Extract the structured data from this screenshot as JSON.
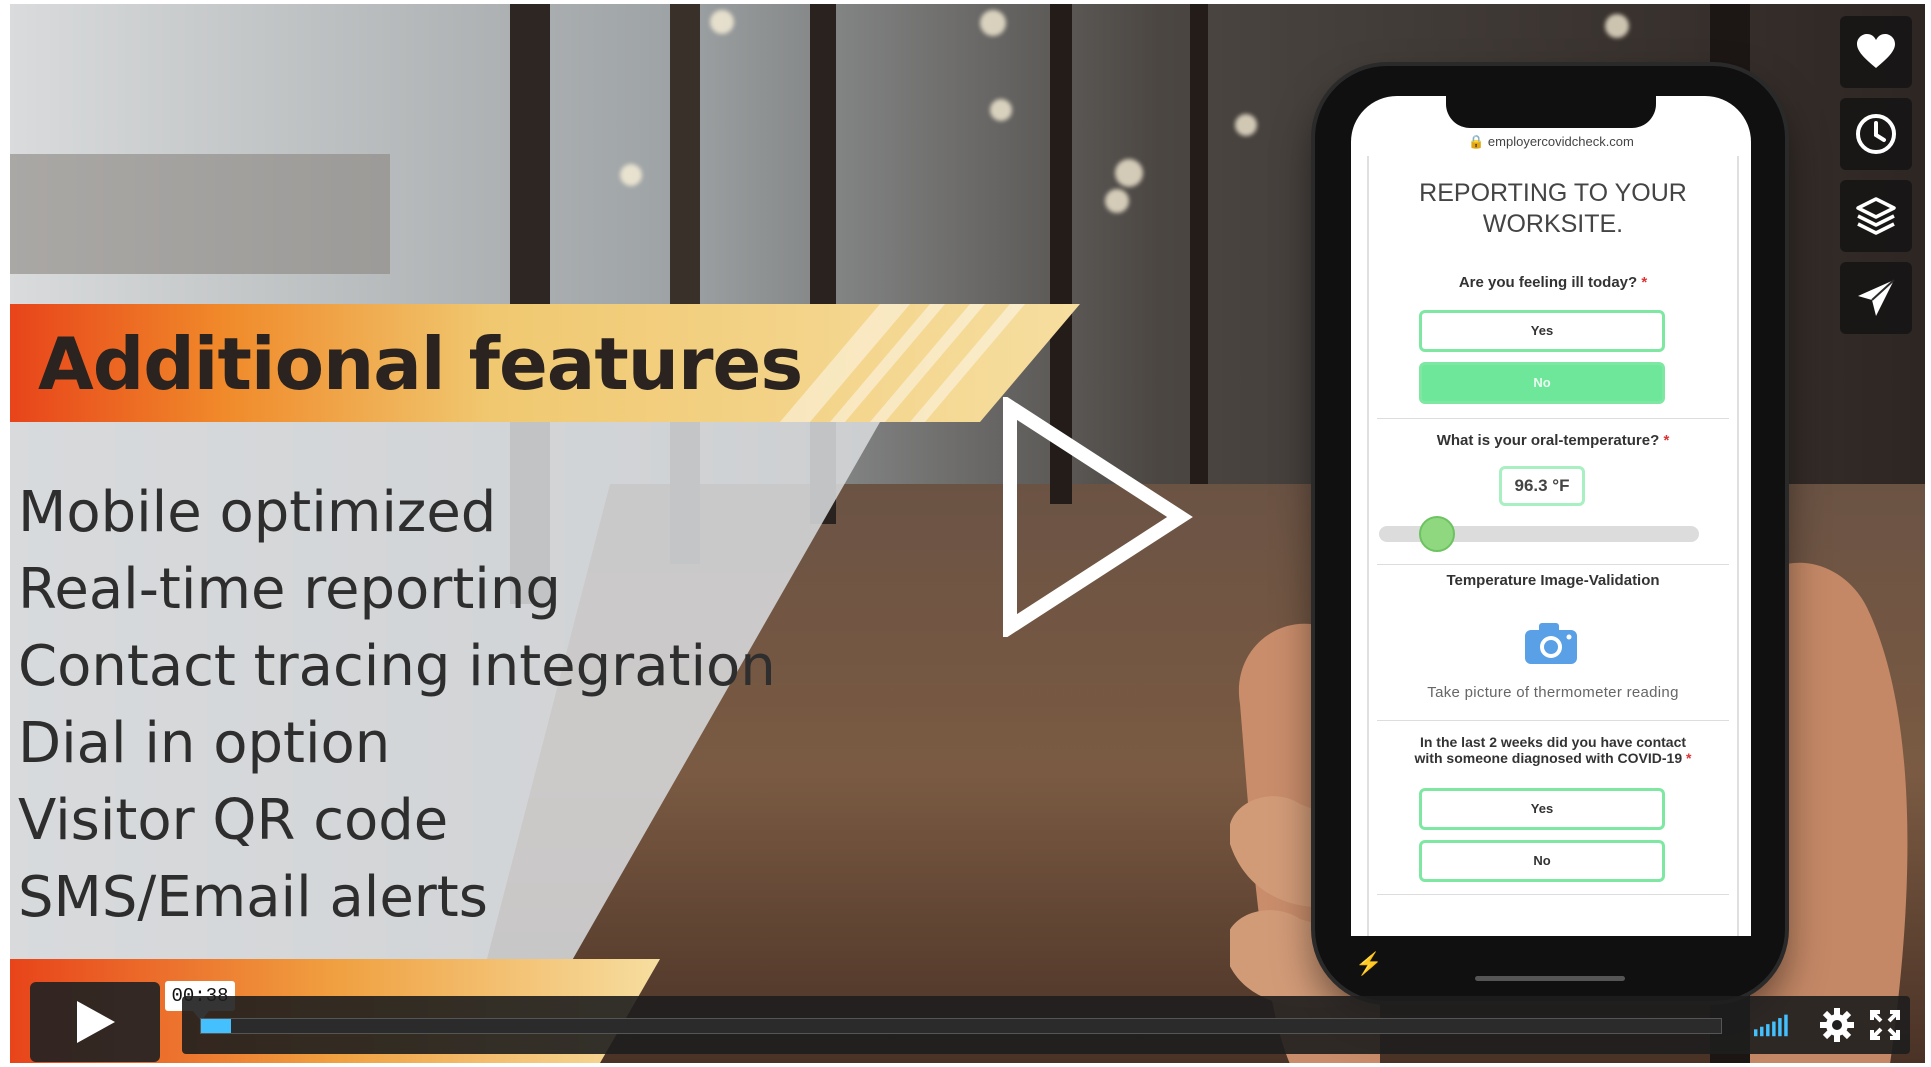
{
  "video": {
    "overlay_title": "Additional features",
    "features": [
      "Mobile optimized",
      "Real-time reporting",
      "Contact tracing integration",
      "Dial in option",
      "Visitor QR code",
      "SMS/Email alerts"
    ]
  },
  "side_actions": [
    {
      "name": "like-button",
      "icon": "heart-icon"
    },
    {
      "name": "watch-later-button",
      "icon": "clock-icon"
    },
    {
      "name": "collections-button",
      "icon": "layers-icon"
    },
    {
      "name": "share-button",
      "icon": "paper-plane-icon"
    }
  ],
  "phone": {
    "url": "employercovidcheck.com",
    "form_title_line1": "REPORTING TO YOUR",
    "form_title_line2": "WORKSITE.",
    "q1": "Are you feeling ill today?",
    "q1_yes": "Yes",
    "q1_no": "No",
    "q2": "What is your oral-temperature?",
    "temperature": "96.3 °F",
    "q3": "Temperature Image-Validation",
    "camera_hint": "Take picture of thermometer reading",
    "q4_line1": "In the last 2 weeks did you have contact",
    "q4_line2": "with someone diagnosed with COVID-19",
    "q4_yes": "Yes",
    "q4_no": "No",
    "required_mark": "*"
  },
  "controls": {
    "current_time": "00:38",
    "progress_fraction": 0.003
  },
  "colors": {
    "accent": "#44c0ff",
    "form_green": "#6ee79a",
    "banner_orange": "#e8561a",
    "banner_gold": "#e9c46a"
  }
}
